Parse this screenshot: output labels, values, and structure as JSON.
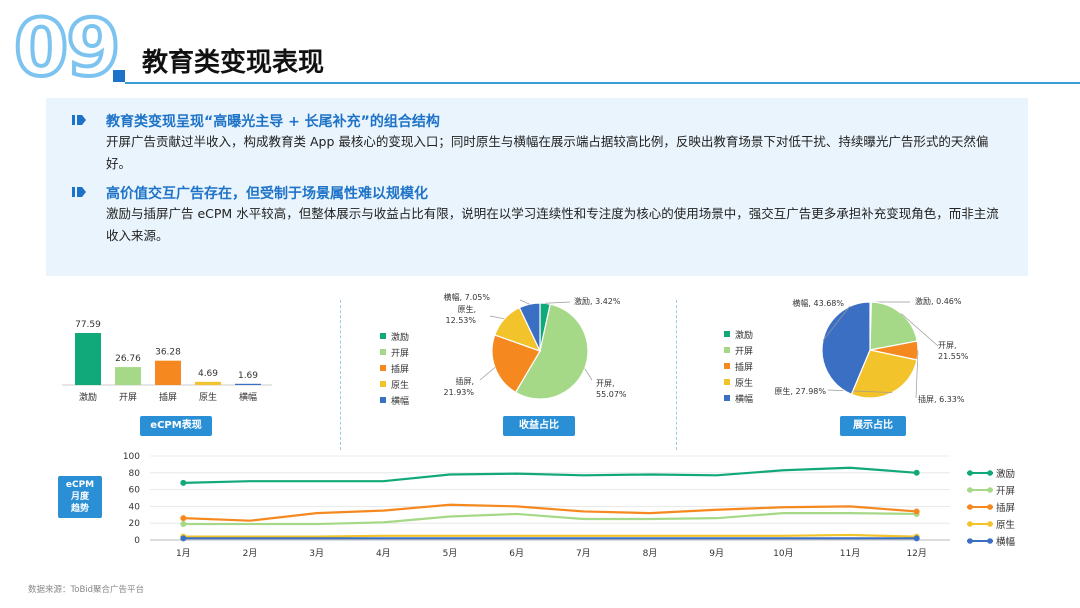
{
  "header": {
    "number": "09",
    "title": "教育类变现表现"
  },
  "insights": [
    {
      "heading": "教育类变现呈现“高曝光主导 + 长尾补充”的组合结构",
      "body": "开屏广告贡献过半收入，构成教育类 App 最核心的变现入口；同时原生与横幅在展示端占据较高比例，反映出教育场景下对低干扰、持续曝光广告形式的天然偏好。"
    },
    {
      "heading": "高价值交互广告存在，但受制于场景属性难以规模化",
      "body": "激励与插屏广告 eCPM 水平较高，但整体展示与收益占比有限，说明在以学习连续性和专注度为核心的使用场景中，强交互广告更多承担补充变现角色，而非主流收入来源。"
    }
  ],
  "colors": {
    "激励": "#12a97a",
    "开屏": "#a6d987",
    "插屏": "#f5891f",
    "原生": "#f2c32b",
    "横幅": "#3a6fc4",
    "accent": "#2b8fd6"
  },
  "panel_labels": {
    "ecpm": "eCPM表现",
    "revenue": "收益占比",
    "display": "展示占比",
    "trend": "eCPM月度趋势"
  },
  "trend_badge_lines": [
    "eCPM",
    "月度",
    "趋势"
  ],
  "legend_items": [
    "激励",
    "开屏",
    "插屏",
    "原生",
    "横幅"
  ],
  "chart_data": [
    {
      "type": "bar",
      "categories": [
        "激励",
        "开屏",
        "插屏",
        "原生",
        "横幅"
      ],
      "values": [
        77.59,
        26.76,
        36.28,
        4.69,
        1.69
      ],
      "value_labels": [
        "77.59",
        "26.76",
        "36.28",
        "4.69",
        "1.69"
      ],
      "title": "eCPM表现"
    },
    {
      "type": "pie",
      "title": "收益占比",
      "labels": [
        "激励",
        "开屏",
        "插屏",
        "原生",
        "横幅"
      ],
      "values": [
        3.42,
        55.07,
        21.93,
        12.53,
        7.05
      ],
      "value_labels": [
        "激励, 3.42%",
        "开屏, 55.07%",
        "插屏, 21.93%",
        "原生, 12.53%",
        "横幅, 7.05%"
      ]
    },
    {
      "type": "pie",
      "title": "展示占比",
      "labels": [
        "激励",
        "开屏",
        "插屏",
        "原生",
        "横幅"
      ],
      "values": [
        0.46,
        21.55,
        6.33,
        27.98,
        43.68
      ],
      "value_labels": [
        "激励, 0.46%",
        "开屏, 21.55%",
        "插屏, 6.33%",
        "原生, 27.98%",
        "横幅, 43.68%"
      ]
    },
    {
      "type": "line",
      "title": "eCPM月度趋势",
      "x": [
        "1月",
        "2月",
        "3月",
        "4月",
        "5月",
        "6月",
        "7月",
        "8月",
        "9月",
        "10月",
        "11月",
        "12月"
      ],
      "ylim": [
        0,
        100
      ],
      "yticks": [
        "0",
        "20",
        "40",
        "60",
        "80",
        "100"
      ],
      "series": [
        {
          "name": "激励",
          "values": [
            68,
            70,
            70,
            70,
            78,
            79,
            77,
            78,
            77,
            83,
            86,
            80
          ]
        },
        {
          "name": "开屏",
          "values": [
            19,
            19,
            19,
            21,
            28,
            31,
            25,
            25,
            26,
            32,
            32,
            31
          ]
        },
        {
          "name": "插屏",
          "values": [
            26,
            23,
            32,
            35,
            42,
            40,
            34,
            32,
            36,
            39,
            40,
            34
          ]
        },
        {
          "name": "原生",
          "values": [
            4,
            4,
            4,
            5,
            5,
            5,
            5,
            5,
            5,
            5,
            6,
            4
          ]
        },
        {
          "name": "横幅",
          "values": [
            2,
            2,
            2,
            2,
            2,
            2,
            2,
            2,
            2,
            2,
            2,
            2
          ]
        }
      ]
    }
  ],
  "source": "数据来源：ToBid聚合广告平台"
}
